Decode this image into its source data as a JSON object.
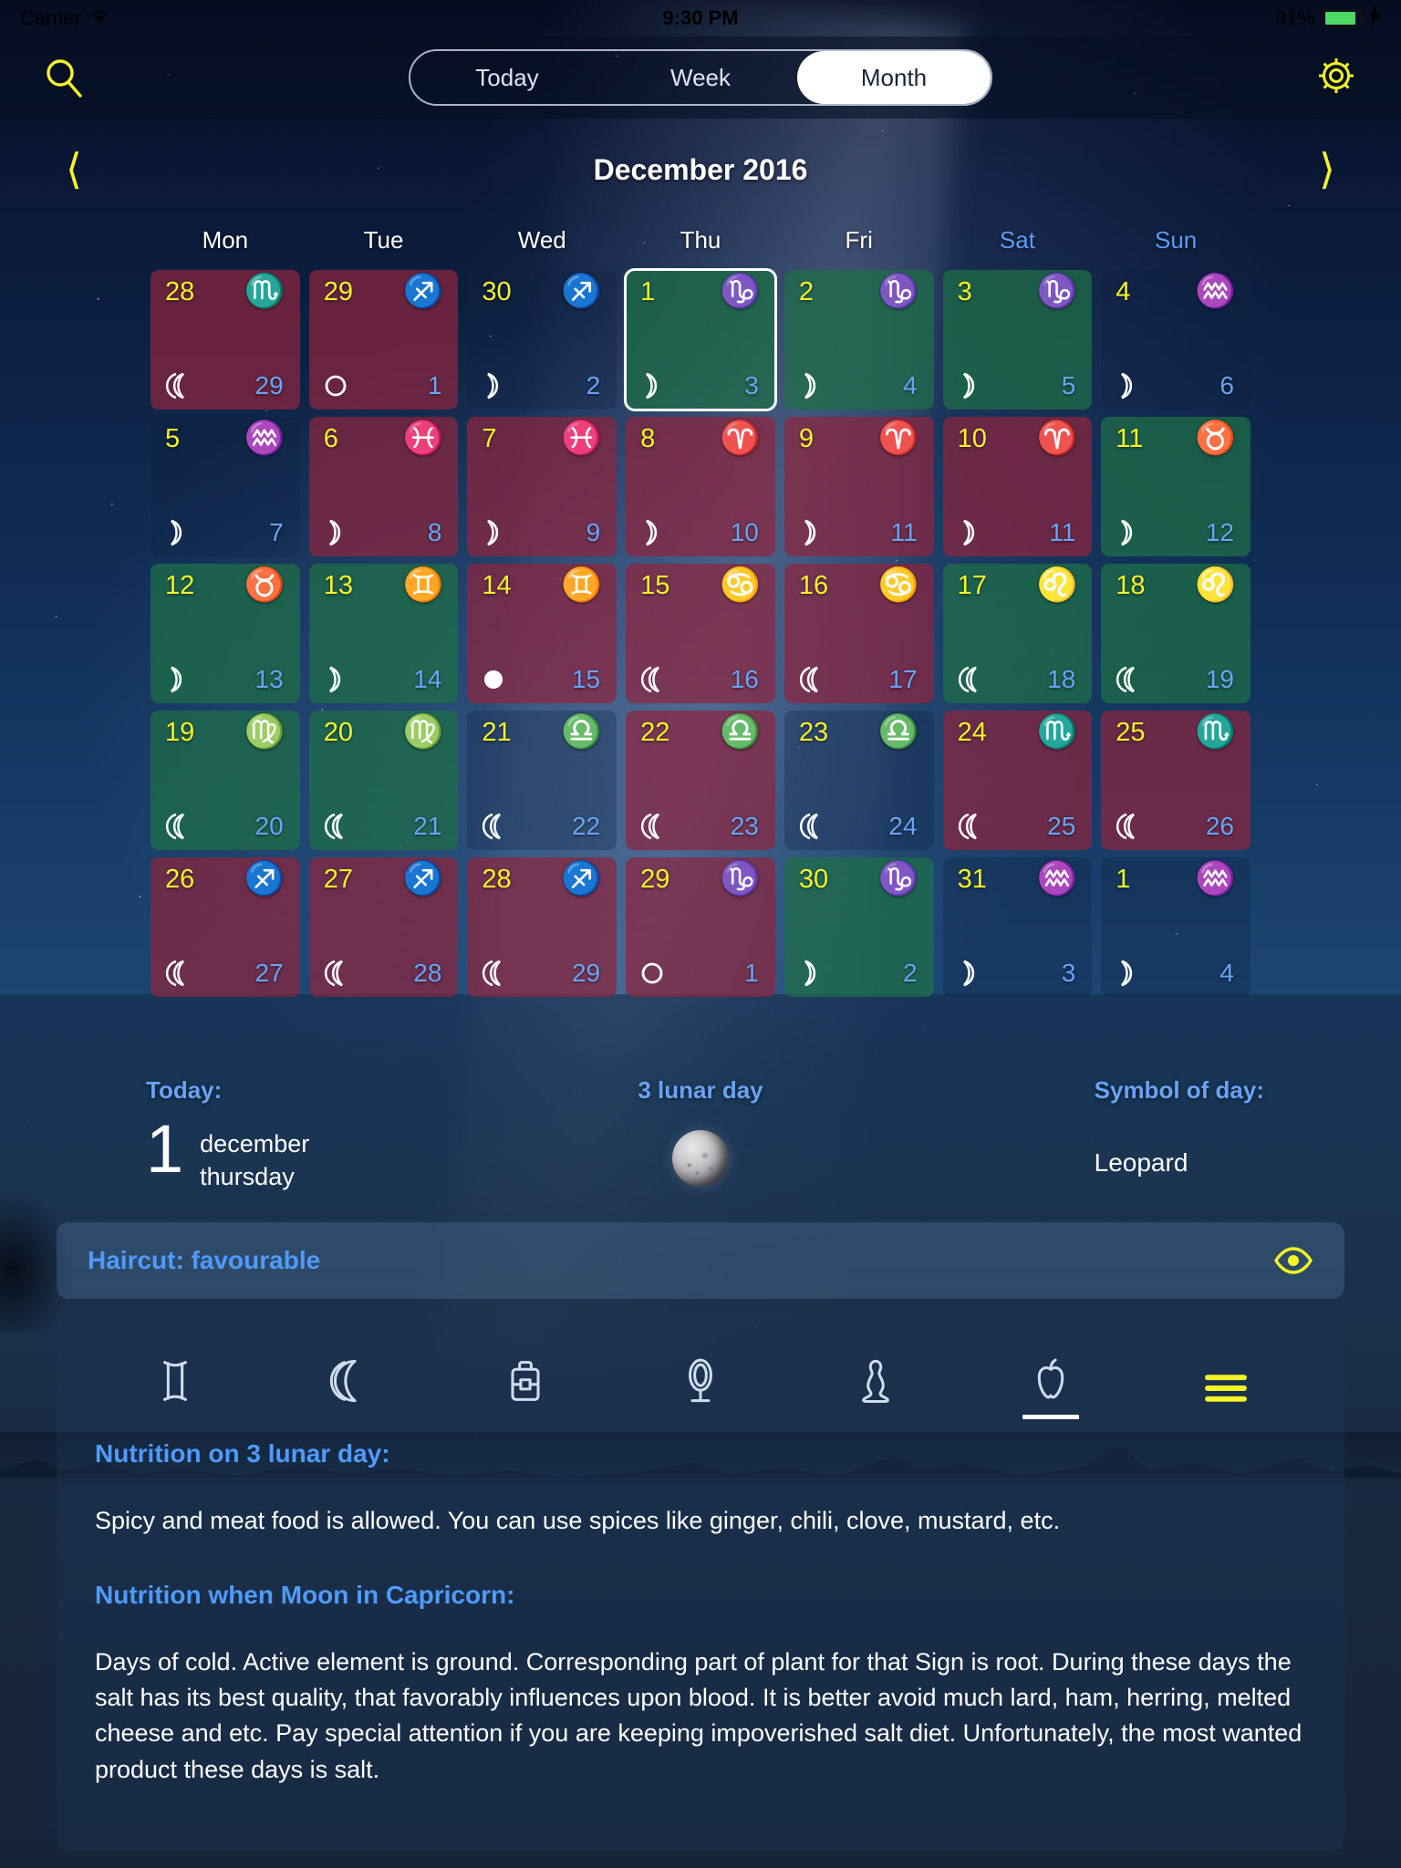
{
  "status_bar": {
    "carrier": "Carrier",
    "wifi_icon": "wifi-icon",
    "time": "9:30 PM",
    "battery_percent": "91%",
    "battery_level": 91
  },
  "top_bar": {
    "search_icon": "search-icon",
    "settings_icon": "gear-icon",
    "segments": [
      {
        "label": "Today",
        "active": false
      },
      {
        "label": "Week",
        "active": false
      },
      {
        "label": "Month",
        "active": true
      }
    ]
  },
  "month_nav": {
    "prev_icon": "chevron-left-icon",
    "next_icon": "chevron-right-icon",
    "title": "December 2016"
  },
  "weekdays": [
    {
      "label": "Mon",
      "weekend": false
    },
    {
      "label": "Tue",
      "weekend": false
    },
    {
      "label": "Wed",
      "weekend": false
    },
    {
      "label": "Thu",
      "weekend": false
    },
    {
      "label": "Fri",
      "weekend": false
    },
    {
      "label": "Sat",
      "weekend": true
    },
    {
      "label": "Sun",
      "weekend": true
    }
  ],
  "colors": {
    "day_number": "#f5f32a",
    "lunar_number": "#69a4f8",
    "accent_blue": "#4f9bff",
    "accent_yellow": "#f2f425",
    "cell_red": "#8c263e",
    "cell_green": "#1e6e48",
    "battery_green": "#4cd964"
  },
  "calendar": {
    "cells": [
      {
        "day": "28",
        "zodiac": "scorpio",
        "zodiac_glyph": "♏",
        "moon": "waning-crescent",
        "lunar": "29",
        "color": "red",
        "today": false
      },
      {
        "day": "29",
        "zodiac": "sagittarius",
        "zodiac_glyph": "♐",
        "moon": "new-moon",
        "lunar": "1",
        "color": "red",
        "today": false
      },
      {
        "day": "30",
        "zodiac": "sagittarius",
        "zodiac_glyph": "♐",
        "moon": "waxing-crescent",
        "lunar": "2",
        "color": "none",
        "today": false
      },
      {
        "day": "1",
        "zodiac": "capricorn",
        "zodiac_glyph": "♑",
        "moon": "waxing-crescent",
        "lunar": "3",
        "color": "green",
        "today": true
      },
      {
        "day": "2",
        "zodiac": "capricorn",
        "zodiac_glyph": "♑",
        "moon": "waxing-crescent",
        "lunar": "4",
        "color": "green",
        "today": false
      },
      {
        "day": "3",
        "zodiac": "capricorn",
        "zodiac_glyph": "♑",
        "moon": "waxing-crescent",
        "lunar": "5",
        "color": "green",
        "today": false
      },
      {
        "day": "4",
        "zodiac": "aquarius",
        "zodiac_glyph": "♒",
        "moon": "waxing-crescent",
        "lunar": "6",
        "color": "none",
        "today": false
      },
      {
        "day": "5",
        "zodiac": "aquarius",
        "zodiac_glyph": "♒",
        "moon": "waxing-crescent",
        "lunar": "7",
        "color": "none",
        "today": false
      },
      {
        "day": "6",
        "zodiac": "pisces",
        "zodiac_glyph": "♓",
        "moon": "waxing-crescent",
        "lunar": "8",
        "color": "red",
        "today": false
      },
      {
        "day": "7",
        "zodiac": "pisces",
        "zodiac_glyph": "♓",
        "moon": "waxing-crescent",
        "lunar": "9",
        "color": "red",
        "today": false
      },
      {
        "day": "8",
        "zodiac": "aries",
        "zodiac_glyph": "♈",
        "moon": "waxing-crescent",
        "lunar": "10",
        "color": "red",
        "today": false
      },
      {
        "day": "9",
        "zodiac": "aries",
        "zodiac_glyph": "♈",
        "moon": "waxing-crescent",
        "lunar": "11",
        "color": "red",
        "today": false
      },
      {
        "day": "10",
        "zodiac": "aries",
        "zodiac_glyph": "♈",
        "moon": "waxing-crescent",
        "lunar": "11",
        "color": "red",
        "today": false
      },
      {
        "day": "11",
        "zodiac": "taurus",
        "zodiac_glyph": "♉",
        "moon": "waxing-crescent",
        "lunar": "12",
        "color": "green",
        "today": false
      },
      {
        "day": "12",
        "zodiac": "taurus",
        "zodiac_glyph": "♉",
        "moon": "waxing-crescent",
        "lunar": "13",
        "color": "green",
        "today": false
      },
      {
        "day": "13",
        "zodiac": "gemini",
        "zodiac_glyph": "♊",
        "moon": "waxing-crescent",
        "lunar": "14",
        "color": "green",
        "today": false
      },
      {
        "day": "14",
        "zodiac": "gemini",
        "zodiac_glyph": "♊",
        "moon": "full-moon",
        "lunar": "15",
        "color": "red",
        "today": false
      },
      {
        "day": "15",
        "zodiac": "cancer",
        "zodiac_glyph": "♋",
        "moon": "waning-crescent",
        "lunar": "16",
        "color": "red",
        "today": false
      },
      {
        "day": "16",
        "zodiac": "cancer",
        "zodiac_glyph": "♋",
        "moon": "waning-crescent",
        "lunar": "17",
        "color": "red",
        "today": false
      },
      {
        "day": "17",
        "zodiac": "leo",
        "zodiac_glyph": "♌",
        "moon": "waning-crescent",
        "lunar": "18",
        "color": "green",
        "today": false
      },
      {
        "day": "18",
        "zodiac": "leo",
        "zodiac_glyph": "♌",
        "moon": "waning-crescent",
        "lunar": "19",
        "color": "green",
        "today": false
      },
      {
        "day": "19",
        "zodiac": "virgo",
        "zodiac_glyph": "♍",
        "moon": "waning-crescent",
        "lunar": "20",
        "color": "green",
        "today": false
      },
      {
        "day": "20",
        "zodiac": "virgo",
        "zodiac_glyph": "♍",
        "moon": "waning-crescent",
        "lunar": "21",
        "color": "green",
        "today": false
      },
      {
        "day": "21",
        "zodiac": "libra",
        "zodiac_glyph": "♎",
        "moon": "waning-crescent",
        "lunar": "22",
        "color": "none",
        "today": false
      },
      {
        "day": "22",
        "zodiac": "libra",
        "zodiac_glyph": "♎",
        "moon": "waning-crescent",
        "lunar": "23",
        "color": "red",
        "today": false
      },
      {
        "day": "23",
        "zodiac": "libra",
        "zodiac_glyph": "♎",
        "moon": "waning-crescent",
        "lunar": "24",
        "color": "none",
        "today": false
      },
      {
        "day": "24",
        "zodiac": "scorpio",
        "zodiac_glyph": "♏",
        "moon": "waning-crescent",
        "lunar": "25",
        "color": "red",
        "today": false
      },
      {
        "day": "25",
        "zodiac": "scorpio",
        "zodiac_glyph": "♏",
        "moon": "waning-crescent",
        "lunar": "26",
        "color": "red",
        "today": false
      },
      {
        "day": "26",
        "zodiac": "sagittarius",
        "zodiac_glyph": "♐",
        "moon": "waning-crescent",
        "lunar": "27",
        "color": "red",
        "today": false
      },
      {
        "day": "27",
        "zodiac": "sagittarius",
        "zodiac_glyph": "♐",
        "moon": "waning-crescent",
        "lunar": "28",
        "color": "red",
        "today": false
      },
      {
        "day": "28",
        "zodiac": "sagittarius",
        "zodiac_glyph": "♐",
        "moon": "waning-crescent",
        "lunar": "29",
        "color": "red",
        "today": false
      },
      {
        "day": "29",
        "zodiac": "capricorn",
        "zodiac_glyph": "♑",
        "moon": "new-moon",
        "lunar": "1",
        "color": "red",
        "today": false
      },
      {
        "day": "30",
        "zodiac": "capricorn",
        "zodiac_glyph": "♑",
        "moon": "waxing-crescent",
        "lunar": "2",
        "color": "green",
        "today": false
      },
      {
        "day": "31",
        "zodiac": "aquarius",
        "zodiac_glyph": "♒",
        "moon": "waxing-crescent",
        "lunar": "3",
        "color": "none",
        "today": false
      },
      {
        "day": "1",
        "zodiac": "aquarius",
        "zodiac_glyph": "♒",
        "moon": "waxing-crescent",
        "lunar": "4",
        "color": "none",
        "today": false
      }
    ]
  },
  "summary": {
    "today_label": "Today:",
    "today_number": "1",
    "today_month": "december",
    "today_weekday": "thursday",
    "lunar_day_label": "3 lunar day",
    "moon_image": "moon-photo",
    "symbol_label": "Symbol of day:",
    "symbol_value": "Leopard"
  },
  "haircut": {
    "text": "Haircut: favourable",
    "eye_icon": "eye-icon"
  },
  "tabs": [
    {
      "name": "zodiac",
      "icon": "gemini-icon",
      "active": false
    },
    {
      "name": "moon",
      "icon": "moon-icon",
      "active": false
    },
    {
      "name": "business",
      "icon": "briefcase-icon",
      "active": false
    },
    {
      "name": "beauty",
      "icon": "mirror-icon",
      "active": false
    },
    {
      "name": "health",
      "icon": "meditation-icon",
      "active": false
    },
    {
      "name": "nutrition",
      "icon": "apple-icon",
      "active": true
    },
    {
      "name": "menu",
      "icon": "hamburger-icon",
      "active": false
    }
  ],
  "content": {
    "heading1": "Nutrition on 3 lunar day:",
    "paragraph1": "Spicy and meat food is allowed. You can use spices like ginger, chili, clove, mustard, etc.",
    "heading2": "Nutrition when Moon in Capricorn:",
    "paragraph2": "Days of cold. Active element is ground. Corresponding part of plant for that Sign is root. During these days the salt has its best quality, that favorably influences upon blood. It is better avoid much lard, ham, herring, melted cheese and etc. Pay special attention if you are keeping impoverished salt diet. Unfortunately, the most wanted product these days is salt."
  }
}
